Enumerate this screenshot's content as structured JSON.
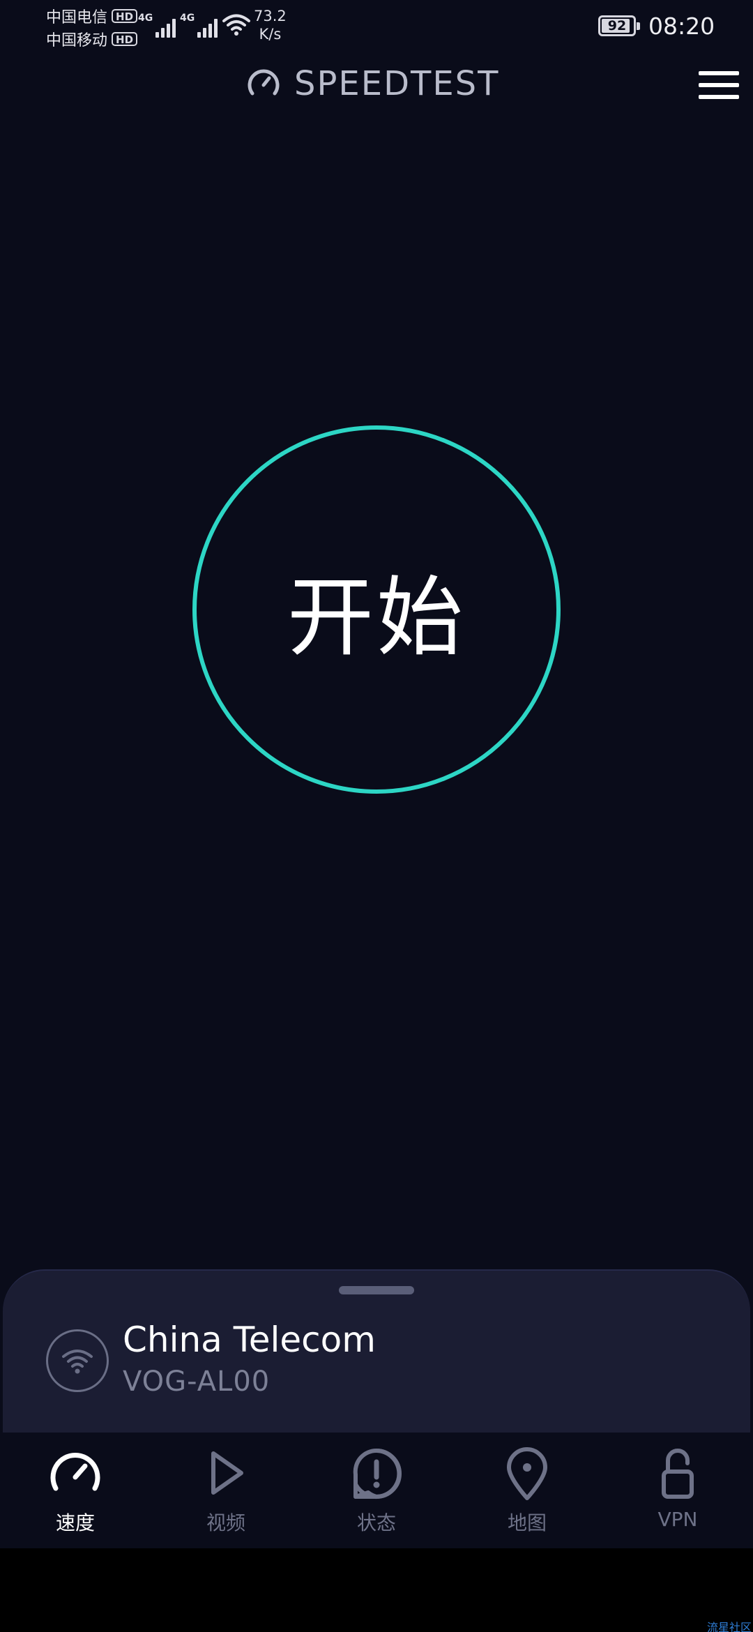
{
  "status_bar": {
    "carrier1": "中国电信",
    "carrier2": "中国移动",
    "hd_badge": "HD",
    "network_type1": "4G",
    "network_type2": "4G",
    "speed_value": "73.2",
    "speed_unit": "K/s",
    "battery_level": "92",
    "time": "08:20"
  },
  "header": {
    "app_title": "SPEEDTEST",
    "menu_icon": "hamburger-menu-icon"
  },
  "main": {
    "go_button_label": "开始",
    "accent_color": "#2dd6c5"
  },
  "connection": {
    "provider": "China Telecom",
    "server": "VOG-AL00",
    "icon": "wifi-icon"
  },
  "tabs": [
    {
      "label": "速度",
      "icon": "speedometer-icon",
      "active": true
    },
    {
      "label": "视频",
      "icon": "play-icon",
      "active": false
    },
    {
      "label": "状态",
      "icon": "alert-icon",
      "active": false
    },
    {
      "label": "地图",
      "icon": "map-pin-icon",
      "active": false
    },
    {
      "label": "VPN",
      "icon": "unlock-icon",
      "active": false
    }
  ],
  "watermark": "流星社区",
  "colors": {
    "background": "#0a0c1a",
    "sheet": "#1b1d33",
    "inactive_tab": "#6e7288"
  }
}
